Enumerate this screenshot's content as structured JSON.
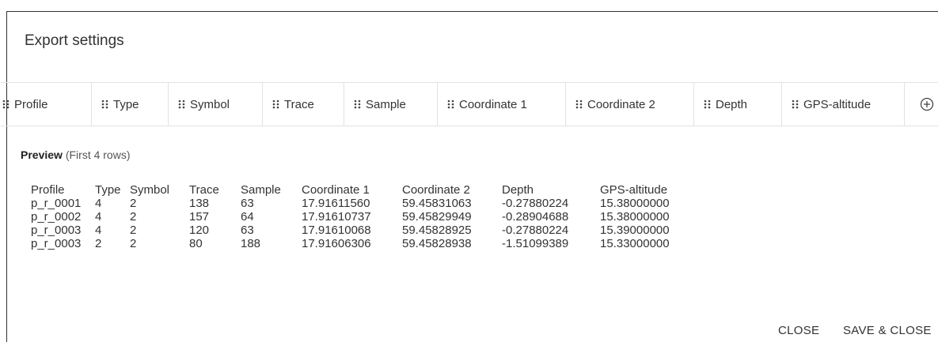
{
  "dialog": {
    "title": "Export settings"
  },
  "columns": [
    {
      "label": "Profile"
    },
    {
      "label": "Type"
    },
    {
      "label": "Symbol"
    },
    {
      "label": "Trace"
    },
    {
      "label": "Sample"
    },
    {
      "label": "Coordinate 1"
    },
    {
      "label": "Coordinate 2"
    },
    {
      "label": "Depth"
    },
    {
      "label": "GPS-altitude"
    }
  ],
  "add_column_icon": "plus-circle-icon",
  "preview": {
    "label_bold": "Preview",
    "label_sub": " (First 4 rows)",
    "headers": [
      "Profile",
      "Type",
      "Symbol",
      "Trace",
      "Sample",
      "Coordinate 1",
      "Coordinate 2",
      "Depth",
      "GPS-altitude"
    ],
    "rows": [
      [
        "p_r_0001",
        "4",
        "2",
        "138",
        "63",
        "17.91611560",
        "59.45831063",
        "-0.27880224",
        "15.38000000"
      ],
      [
        "p_r_0002",
        "4",
        "2",
        "157",
        "64",
        "17.91610737",
        "59.45829949",
        "-0.28904688",
        "15.38000000"
      ],
      [
        "p_r_0003",
        "4",
        "2",
        "120",
        "63",
        "17.91610068",
        "59.45828925",
        "-0.27880224",
        "15.39000000"
      ],
      [
        "p_r_0003",
        "2",
        "2",
        "80",
        "188",
        "17.91606306",
        "59.45828938",
        "-1.51099389",
        "15.33000000"
      ]
    ]
  },
  "footer": {
    "close_label": "CLOSE",
    "save_close_label": "SAVE & CLOSE"
  },
  "colors": {
    "text": "#333333",
    "border": "#e2e2e2",
    "dialog_border": "#333333"
  }
}
